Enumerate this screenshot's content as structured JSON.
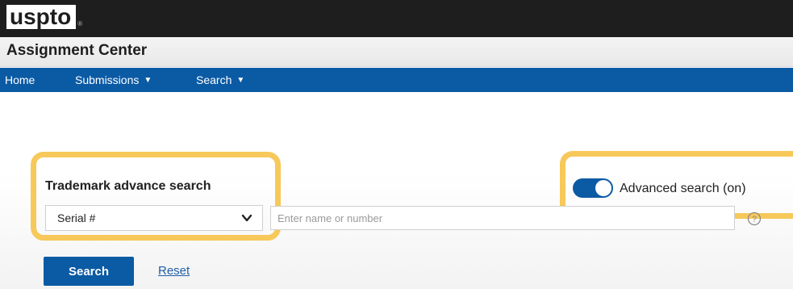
{
  "brand": {
    "logo_text": "uspto",
    "logo_mark": "®"
  },
  "app": {
    "title": "Assignment Center"
  },
  "nav": {
    "items": [
      {
        "label": "Home"
      },
      {
        "label": "Submissions"
      },
      {
        "label": "Search"
      }
    ]
  },
  "search": {
    "section_label": "Trademark advance search",
    "type_select": {
      "value": "Serial #"
    },
    "query_input": {
      "value": "",
      "placeholder": "Enter name or number"
    },
    "advanced_toggle": {
      "label": "Advanced search (on)",
      "on": true
    },
    "search_button": "Search",
    "reset_link": "Reset"
  },
  "colors": {
    "accent": "#0b5aa4",
    "highlight": "#f7c85a",
    "topbar": "#1e1e1e"
  }
}
